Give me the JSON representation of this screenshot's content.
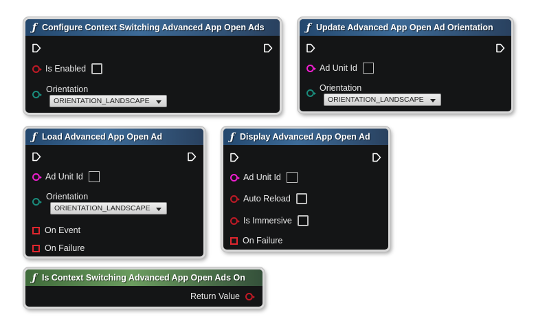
{
  "colors": {
    "header_blue": "#3d6b98",
    "header_green": "#6b9c5f",
    "node_body": "#141516",
    "pin_bool": "#c11a26",
    "pin_string": "#f01fd0",
    "pin_enum": "#1a8c7c",
    "pin_event": "#e0262e"
  },
  "icons": {
    "function": "ƒ"
  },
  "nodes": {
    "configure": {
      "title": "Configure Context Switching Advanced App Open Ads",
      "is_enabled_label": "Is Enabled",
      "orientation_label": "Orientation",
      "orientation_value": "ORIENTATION_LANDSCAPE"
    },
    "update": {
      "title": "Update Advanced App Open Ad Orientation",
      "ad_unit_label": "Ad Unit Id",
      "orientation_label": "Orientation",
      "orientation_value": "ORIENTATION_LANDSCAPE"
    },
    "load": {
      "title": "Load Advanced App Open Ad",
      "ad_unit_label": "Ad Unit Id",
      "orientation_label": "Orientation",
      "orientation_value": "ORIENTATION_LANDSCAPE",
      "on_event_label": "On Event",
      "on_failure_label": "On Failure"
    },
    "display": {
      "title": "Display Advanced App Open Ad",
      "ad_unit_label": "Ad Unit Id",
      "auto_reload_label": "Auto Reload",
      "is_immersive_label": "Is Immersive",
      "on_failure_label": "On Failure"
    },
    "is_context": {
      "title": "Is Context Switching Advanced App Open Ads On",
      "return_label": "Return Value"
    }
  }
}
